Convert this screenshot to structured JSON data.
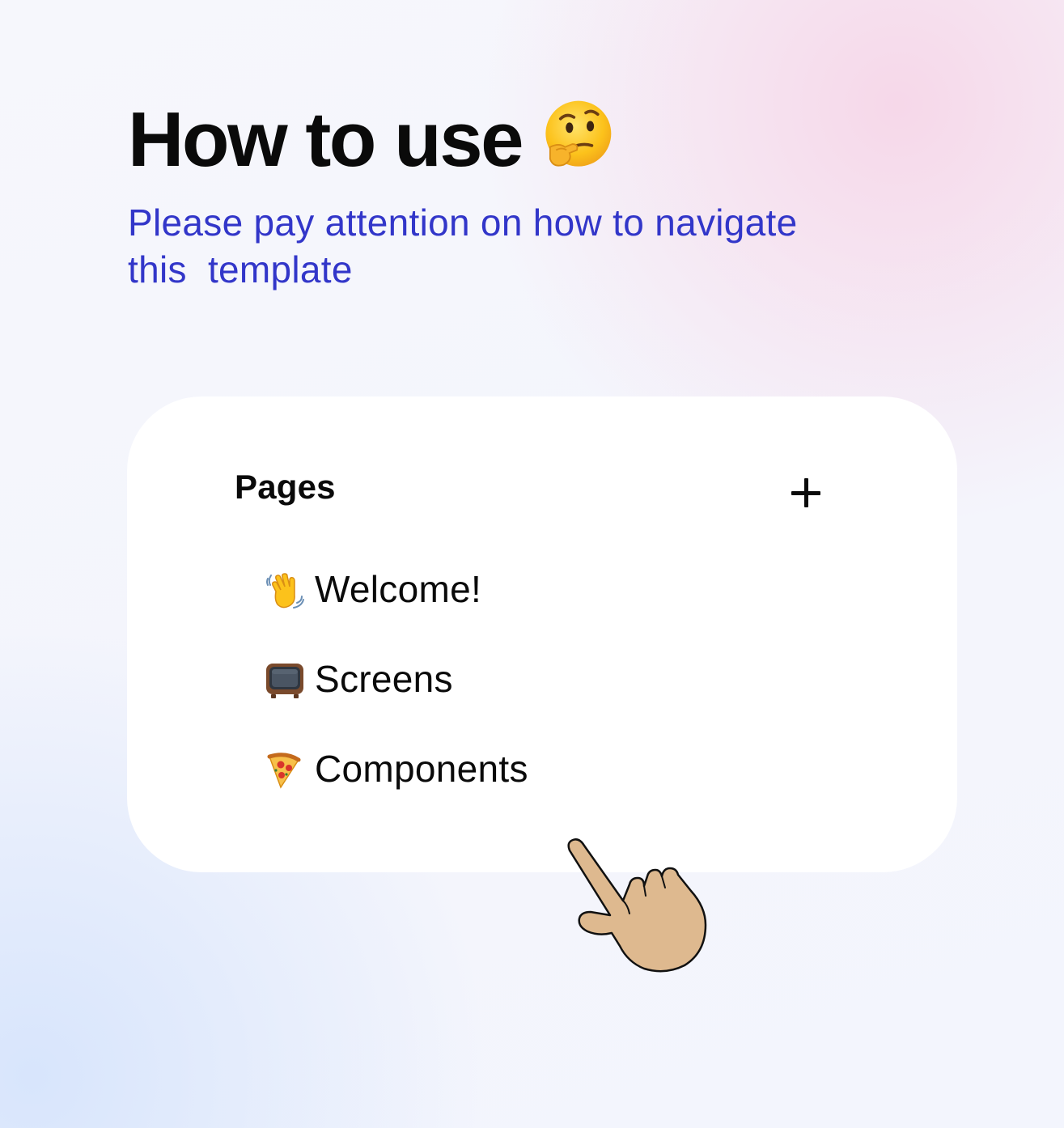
{
  "header": {
    "title": "How to use",
    "title_emoji": "thinking-face-icon",
    "subtitle": "Please pay attention on how to navigate\nthis  template"
  },
  "pages_panel": {
    "heading": "Pages",
    "add_icon": "plus-icon",
    "items": [
      {
        "icon": "waving-hand-icon",
        "label": "Welcome!"
      },
      {
        "icon": "television-icon",
        "label": "Screens"
      },
      {
        "icon": "pizza-icon",
        "label": "Components"
      }
    ]
  },
  "pointer": {
    "icon": "pointing-hand-cursor-icon"
  },
  "colors": {
    "title": "#0a0a0a",
    "subtitle": "#3236c9",
    "card_background": "#ffffff",
    "hand_skin": "#deb98f"
  }
}
